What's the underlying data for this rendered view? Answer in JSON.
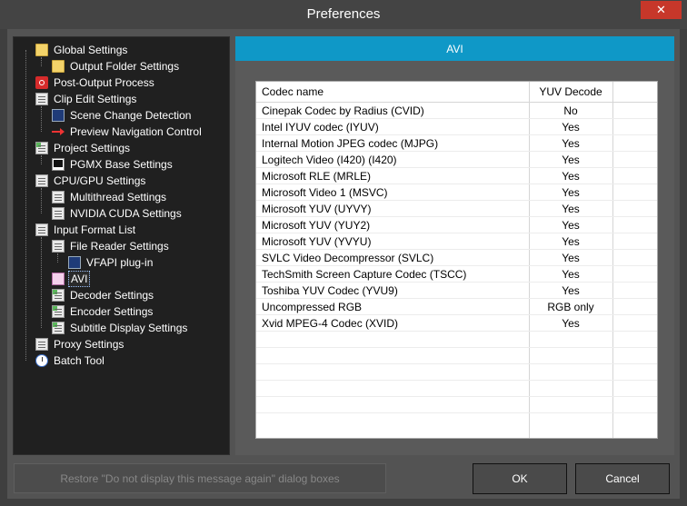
{
  "window": {
    "title": "Preferences",
    "close_glyph": "✕"
  },
  "tree": {
    "items": [
      {
        "label": "Global Settings",
        "icon": "folder-icon"
      },
      {
        "label": "Output Folder Settings",
        "icon": "folder-icon"
      },
      {
        "label": "Post-Output Process",
        "icon": "red-process-icon"
      },
      {
        "label": "Clip Edit Settings",
        "icon": "page-icon"
      },
      {
        "label": "Scene Change Detection",
        "icon": "film-icon"
      },
      {
        "label": "Preview Navigation Control",
        "icon": "arrow-icon"
      },
      {
        "label": "Project Settings",
        "icon": "page-icon"
      },
      {
        "label": "PGMX Base Settings",
        "icon": "monitor-icon"
      },
      {
        "label": "CPU/GPU Settings",
        "icon": "page-icon"
      },
      {
        "label": "Multithread Settings",
        "icon": "page-icon"
      },
      {
        "label": "NVIDIA CUDA Settings",
        "icon": "page-icon"
      },
      {
        "label": "Input Format List",
        "icon": "page-icon"
      },
      {
        "label": "File Reader Settings",
        "icon": "page-icon"
      },
      {
        "label": "VFAPI plug-in",
        "icon": "film-icon"
      },
      {
        "label": "AVI",
        "icon": "pink-page-icon"
      },
      {
        "label": "Decoder Settings",
        "icon": "page-icon"
      },
      {
        "label": "Encoder Settings",
        "icon": "page-icon"
      },
      {
        "label": "Subtitle Display Settings",
        "icon": "page-icon"
      },
      {
        "label": "Proxy Settings",
        "icon": "page-icon"
      },
      {
        "label": "Batch Tool",
        "icon": "clock-icon"
      }
    ],
    "selected": "AVI"
  },
  "panel": {
    "title": "AVI",
    "columns": {
      "name": "Codec name",
      "yuv": "YUV Decode"
    },
    "rows": [
      {
        "name": "Cinepak Codec by Radius (CVID)",
        "yuv": "No"
      },
      {
        "name": "Intel IYUV codec (IYUV)",
        "yuv": "Yes"
      },
      {
        "name": "Internal Motion JPEG codec (MJPG)",
        "yuv": "Yes"
      },
      {
        "name": "Logitech Video (I420) (I420)",
        "yuv": "Yes"
      },
      {
        "name": "Microsoft RLE (MRLE)",
        "yuv": "Yes"
      },
      {
        "name": "Microsoft Video 1 (MSVC)",
        "yuv": "Yes"
      },
      {
        "name": "Microsoft YUV (UYVY)",
        "yuv": "Yes"
      },
      {
        "name": "Microsoft YUV (YUY2)",
        "yuv": "Yes"
      },
      {
        "name": "Microsoft YUV (YVYU)",
        "yuv": "Yes"
      },
      {
        "name": "SVLC Video Decompressor (SVLC)",
        "yuv": "Yes"
      },
      {
        "name": "TechSmith Screen Capture Codec (TSCC)",
        "yuv": "Yes"
      },
      {
        "name": "Toshiba YUV Codec (YVU9)",
        "yuv": "Yes"
      },
      {
        "name": "Uncompressed RGB",
        "yuv": "RGB only"
      },
      {
        "name": "Xvid MPEG-4 Codec (XVID)",
        "yuv": "Yes"
      }
    ]
  },
  "buttons": {
    "restore": "Restore \"Do not display this message again\" dialog boxes",
    "ok": "OK",
    "cancel": "Cancel"
  },
  "colors": {
    "accent": "#0f98c7",
    "close": "#c7372a"
  }
}
